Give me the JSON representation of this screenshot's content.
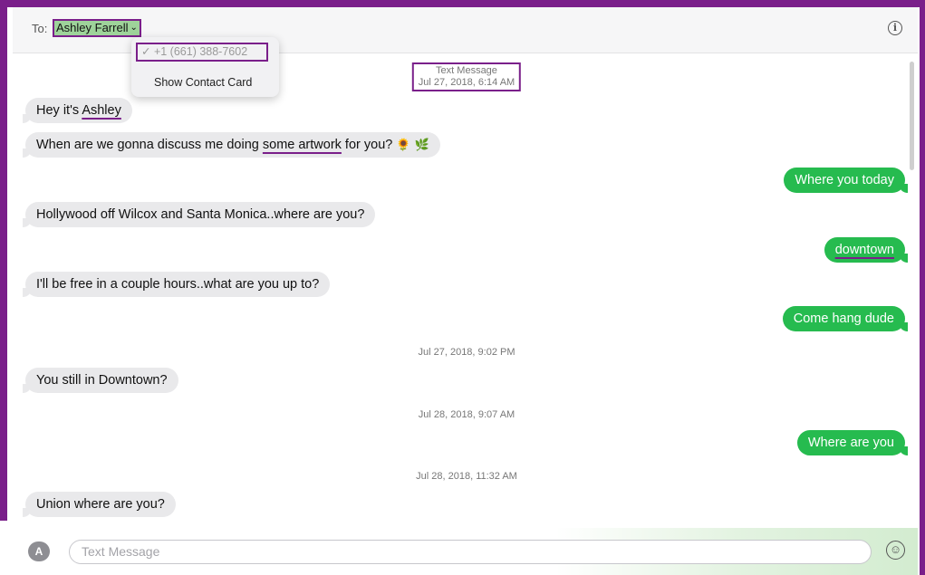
{
  "header": {
    "to_label": "To:",
    "recipient": "Ashley Farrell"
  },
  "dropdown": {
    "phone": "+1 (661) 388-7602",
    "show_contact_card": "Show Contact Card"
  },
  "conversation": {
    "ts1_type": "Text Message",
    "ts1_date": "Jul 27, 2018, 6:14 AM",
    "m1_pre": "Hey it's ",
    "m1_name": "Ashley",
    "m2_pre": "When are we gonna discuss me doing ",
    "m2_link": "some artwork",
    "m2_post": " for you?",
    "m2_emoji": "🌻 🌿",
    "m3": "Where you today",
    "m4": "Hollywood off Wilcox and Santa Monica..where are you?",
    "m5": "downtown",
    "m6": "I'll be free in a couple hours..what are you up to?",
    "m7": "Come hang dude",
    "ts2": "Jul 27, 2018, 9:02 PM",
    "m8": "You still in Downtown?",
    "ts3": "Jul 28, 2018, 9:07 AM",
    "m9": "Where are you",
    "ts4": "Jul 28, 2018, 11:32 AM",
    "m10": "Union where are you?"
  },
  "composer": {
    "placeholder": "Text Message",
    "apps_icon": "app-store-icon",
    "emoji_icon": "emoji-icon"
  },
  "colors": {
    "outgoing": "#26bb4f",
    "incoming": "#e9e9eb",
    "annotation": "#7a1f8a",
    "recipient_highlight": "#9ed39a"
  }
}
